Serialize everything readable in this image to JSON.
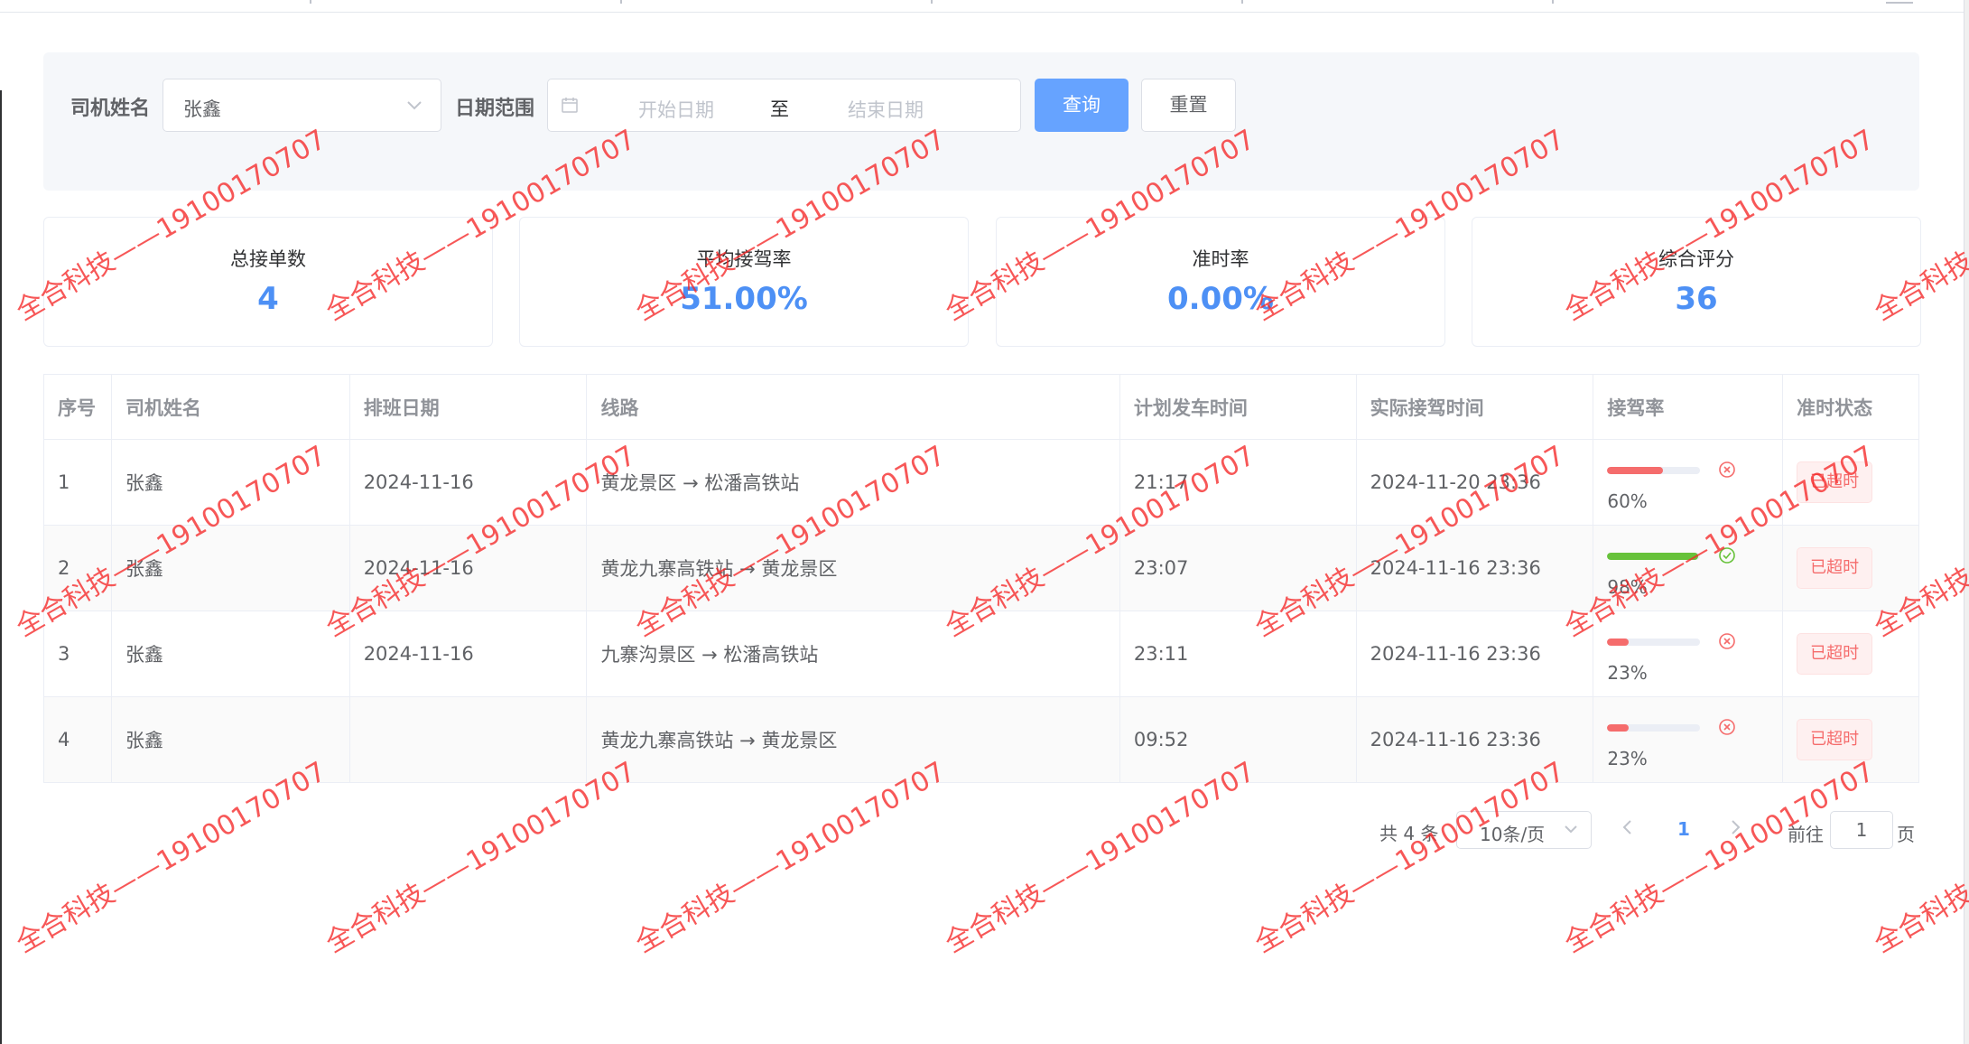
{
  "filters": {
    "driver_label": "司机姓名",
    "driver_value": "张鑫",
    "date_label": "日期范围",
    "date_start_placeholder": "开始日期",
    "date_separator": "至",
    "date_end_placeholder": "结束日期",
    "query_button": "查询",
    "reset_button": "重置"
  },
  "stats": [
    {
      "title": "总接单数",
      "value": "4"
    },
    {
      "title": "平均接驾率",
      "value": "51.00%"
    },
    {
      "title": "准时率",
      "value": "0.00%"
    },
    {
      "title": "综合评分",
      "value": "36"
    }
  ],
  "table": {
    "columns": [
      "序号",
      "司机姓名",
      "排班日期",
      "线路",
      "计划发车时间",
      "实际接驾时间",
      "接驾率",
      "准时状态"
    ],
    "rows": [
      {
        "index": "1",
        "driver": "张鑫",
        "date": "2024-11-16",
        "route": "黄龙景区 → 松潘高铁站",
        "planned": "21:17",
        "actual": "2024-11-20 23:36",
        "rate": 60,
        "rate_text": "60%",
        "rate_status": "error",
        "status": "已超时"
      },
      {
        "index": "2",
        "driver": "张鑫",
        "date": "2024-11-16",
        "route": "黄龙九寨高铁站 → 黄龙景区",
        "planned": "23:07",
        "actual": "2024-11-16 23:36",
        "rate": 98,
        "rate_text": "98%",
        "rate_status": "success",
        "status": "已超时"
      },
      {
        "index": "3",
        "driver": "张鑫",
        "date": "2024-11-16",
        "route": "九寨沟景区 → 松潘高铁站",
        "planned": "23:11",
        "actual": "2024-11-16 23:36",
        "rate": 23,
        "rate_text": "23%",
        "rate_status": "error",
        "status": "已超时"
      },
      {
        "index": "4",
        "driver": "张鑫",
        "date": "",
        "route": "黄龙九寨高铁站 → 黄龙景区",
        "planned": "09:52",
        "actual": "2024-11-16 23:36",
        "rate": 23,
        "rate_text": "23%",
        "rate_status": "error",
        "status": "已超时"
      }
    ]
  },
  "pagination": {
    "total": "共 4 条",
    "page_size": "10条/页",
    "current_page": "1",
    "goto_label": "前往",
    "goto_value": "1",
    "goto_unit": "页"
  },
  "watermark": "全合科技——19100170707",
  "colors": {
    "primary": "#4d90f5",
    "button_primary": "#66a3ff",
    "error": "#f56c6c",
    "success": "#67c23a",
    "panel_bg": "#f5f7fa"
  },
  "icons": {
    "select_arrow": "chevron-down-icon",
    "date": "calendar-icon",
    "rate_error": "circle-close-icon",
    "rate_success": "circle-check-icon",
    "prev": "chevron-left-icon",
    "next": "chevron-right-icon"
  }
}
